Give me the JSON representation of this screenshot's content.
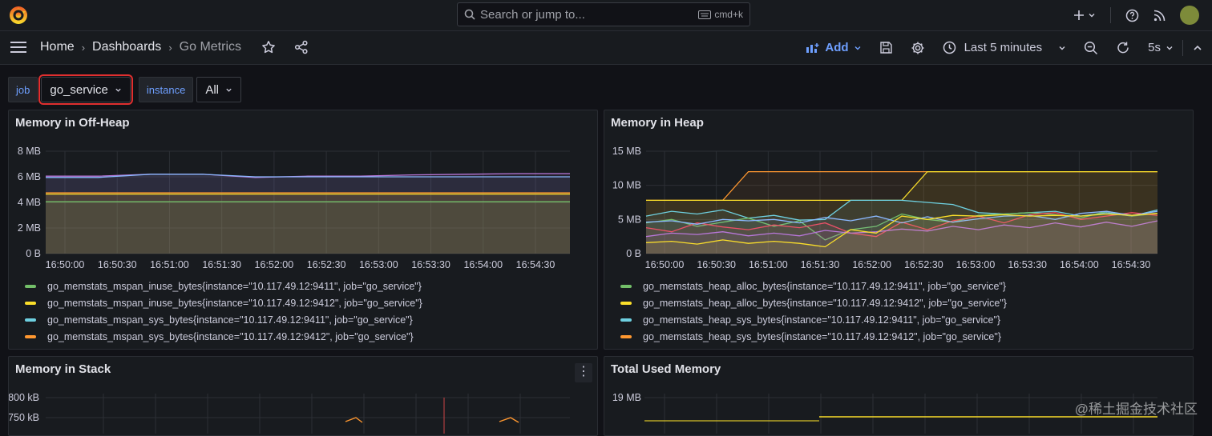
{
  "topbar": {
    "search_placeholder": "Search or jump to...",
    "search_shortcut": "cmd+k"
  },
  "breadcrumb": [
    "Home",
    "Dashboards",
    "Go Metrics"
  ],
  "toolbar": {
    "add_label": "Add",
    "time_range": "Last 5 minutes",
    "refresh_interval": "5s"
  },
  "variables": [
    {
      "label": "job",
      "value": "go_service",
      "highlighted": true
    },
    {
      "label": "instance",
      "value": "All"
    }
  ],
  "colors": {
    "green": "#73bf69",
    "yellow": "#fade2a",
    "blue": "#8ab8ff",
    "cyan": "#6ed0e0",
    "orange": "#ff9830",
    "red": "#f2495c",
    "purple": "#b877d9",
    "highlight": "#e02f2f"
  },
  "panels": [
    {
      "title": "Memory in Off-Heap",
      "legend": [
        {
          "label": "go_memstats_mspan_inuse_bytes{instance=\"10.117.49.12:9411\", job=\"go_service\"}",
          "color": "#73bf69"
        },
        {
          "label": "go_memstats_mspan_inuse_bytes{instance=\"10.117.49.12:9412\", job=\"go_service\"}",
          "color": "#fade2a"
        },
        {
          "label": "go_memstats_mspan_sys_bytes{instance=\"10.117.49.12:9411\", job=\"go_service\"}",
          "color": "#6ed0e0"
        },
        {
          "label": "go_memstats_mspan_sys_bytes{instance=\"10.117.49.12:9412\", job=\"go_service\"}",
          "color": "#ff9830"
        }
      ]
    },
    {
      "title": "Memory in Heap",
      "legend": [
        {
          "label": "go_memstats_heap_alloc_bytes{instance=\"10.117.49.12:9411\", job=\"go_service\"}",
          "color": "#73bf69"
        },
        {
          "label": "go_memstats_heap_alloc_bytes{instance=\"10.117.49.12:9412\", job=\"go_service\"}",
          "color": "#fade2a"
        },
        {
          "label": "go_memstats_heap_sys_bytes{instance=\"10.117.49.12:9411\", job=\"go_service\"}",
          "color": "#6ed0e0"
        },
        {
          "label": "go_memstats_heap_sys_bytes{instance=\"10.117.49.12:9412\", job=\"go_service\"}",
          "color": "#ff9830"
        }
      ]
    },
    {
      "title": "Memory in Stack"
    },
    {
      "title": "Total Used Memory"
    }
  ],
  "chart_data": [
    {
      "type": "line",
      "title": "Memory in Off-Heap",
      "x": [
        "16:50:00",
        "16:50:30",
        "16:51:00",
        "16:51:30",
        "16:52:00",
        "16:52:30",
        "16:53:00",
        "16:53:30",
        "16:54:00",
        "16:54:30"
      ],
      "yticks": [
        "0 B",
        "2 MB",
        "4 MB",
        "6 MB",
        "8 MB"
      ],
      "ylim": [
        0,
        8
      ],
      "series": [
        {
          "color": "#b877d9",
          "values": [
            6.05,
            6.05,
            6.2,
            6.2,
            5.95,
            6.05,
            6.05,
            6.15,
            6.2,
            6.25,
            6.25
          ]
        },
        {
          "color": "#8ab8ff",
          "values": [
            5.95,
            5.95,
            6.2,
            6.2,
            6.0,
            6.0,
            6.0,
            6.0,
            6.0,
            6.0,
            6.0
          ]
        },
        {
          "color": "#ff9830",
          "values": [
            4.75,
            4.75,
            4.75,
            4.75,
            4.75,
            4.75,
            4.75,
            4.75,
            4.75,
            4.75,
            4.75
          ]
        },
        {
          "color": "#fade2a",
          "values": [
            4.65,
            4.65,
            4.65,
            4.65,
            4.65,
            4.65,
            4.65,
            4.65,
            4.65,
            4.65,
            4.65
          ]
        },
        {
          "color": "#73bf69",
          "values": [
            4.05,
            4.05,
            4.05,
            4.05,
            4.05,
            4.05,
            4.05,
            4.05,
            4.05,
            4.05,
            4.05
          ]
        }
      ]
    },
    {
      "type": "line",
      "title": "Memory in Heap",
      "x": [
        "16:50:00",
        "16:50:30",
        "16:51:00",
        "16:51:30",
        "16:52:00",
        "16:52:30",
        "16:53:00",
        "16:53:30",
        "16:54:00",
        "16:54:30"
      ],
      "yticks": [
        "0 B",
        "5 MB",
        "10 MB",
        "15 MB"
      ],
      "ylim": [
        0,
        15
      ],
      "series": [
        {
          "color": "#ff9830",
          "values": [
            7.8,
            7.8,
            7.8,
            7.8,
            12.0,
            12.0,
            12.0,
            12.0,
            12.0,
            12.0,
            12.0,
            12.0,
            12.0,
            12.0,
            12.0,
            12.0,
            12.0,
            12.0,
            12.0,
            12.0,
            12.0
          ]
        },
        {
          "color": "#fade2a",
          "values": [
            7.8,
            7.8,
            7.8,
            7.8,
            7.8,
            7.8,
            7.8,
            7.8,
            7.8,
            7.8,
            7.8,
            12.0,
            12.0,
            12.0,
            12.0,
            12.0,
            12.0,
            12.0,
            12.0,
            12.0,
            12.0
          ]
        },
        {
          "color": "#6ed0e0",
          "values": [
            5.5,
            6.2,
            5.8,
            6.4,
            5.2,
            5.6,
            4.9,
            5.0,
            7.8,
            7.8,
            7.8,
            7.5,
            7.2,
            6.0,
            5.8,
            6.0,
            6.2,
            5.5,
            6.0,
            5.5,
            6.4
          ]
        },
        {
          "color": "#73bf69",
          "values": [
            4.5,
            5.0,
            4.0,
            4.6,
            5.2,
            4.0,
            4.8,
            2.0,
            3.5,
            4.0,
            5.8,
            5.0,
            4.6,
            5.6,
            5.8,
            6.0,
            5.7,
            5.2,
            6.2,
            5.5,
            5.9
          ]
        },
        {
          "color": "#f2495c",
          "values": [
            3.8,
            3.2,
            4.5,
            3.9,
            3.5,
            4.2,
            3.8,
            4.5,
            3.0,
            2.5,
            4.6,
            3.5,
            4.8,
            5.5,
            4.5,
            5.7,
            6.0,
            5.0,
            5.5,
            6.0,
            5.6
          ]
        },
        {
          "color": "#8ab8ff",
          "values": [
            4.6,
            4.8,
            4.3,
            5.0,
            4.8,
            5.0,
            4.5,
            5.3,
            4.8,
            5.5,
            4.5,
            5.4,
            4.6,
            5.1,
            5.5,
            5.6,
            5.0,
            5.9,
            6.2,
            5.6,
            6.2
          ]
        },
        {
          "color": "#b877d9",
          "values": [
            2.5,
            3.0,
            2.8,
            3.2,
            2.6,
            3.0,
            2.6,
            3.4,
            3.0,
            3.2,
            3.6,
            3.3,
            4.0,
            3.5,
            4.2,
            3.8,
            4.5,
            3.9,
            4.6,
            4.0,
            4.8
          ]
        },
        {
          "color": "#fade2a",
          "values": [
            1.6,
            1.8,
            1.4,
            2.0,
            1.5,
            1.8,
            1.5,
            1.0,
            3.5,
            3.0,
            5.5,
            5.0,
            5.6,
            5.5,
            5.7,
            5.5,
            5.6,
            5.5,
            5.8,
            5.6,
            5.9
          ]
        }
      ]
    },
    {
      "type": "line",
      "title": "Memory in Stack",
      "yticks": [
        "800 kB",
        "750 kB"
      ]
    },
    {
      "type": "line",
      "title": "Total Used Memory",
      "yticks": [
        "19 MB"
      ]
    }
  ],
  "watermark": "@稀土掘金技术社区"
}
